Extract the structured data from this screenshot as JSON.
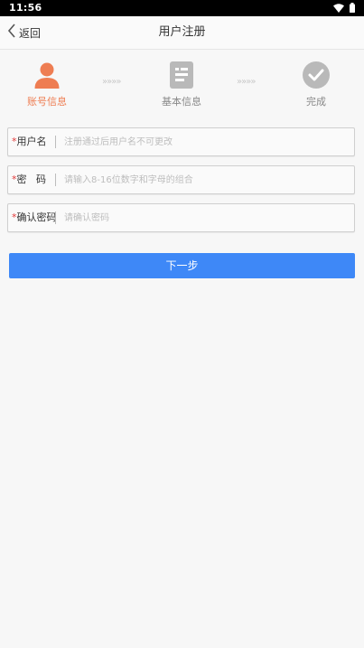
{
  "status_bar": {
    "time": "11:56",
    "icons": [
      "wifi-icon",
      "battery-icon"
    ]
  },
  "nav": {
    "back_label": "返回",
    "title": "用户注册"
  },
  "steps": [
    {
      "label": "账号信息",
      "icon": "user-icon",
      "active": true
    },
    {
      "label": "基本信息",
      "icon": "document-icon",
      "active": false
    },
    {
      "label": "完成",
      "icon": "check-circle-icon",
      "active": false
    }
  ],
  "step_arrow": "»»»»",
  "form": {
    "username": {
      "label": "用户名",
      "placeholder": "注册通过后用户名不可更改",
      "required_mark": "*"
    },
    "password": {
      "label": "密   码",
      "placeholder": "请输入8-16位数字和字母的组合",
      "required_mark": "*"
    },
    "confirm": {
      "label": "确认密码",
      "placeholder": "请确认密码",
      "required_mark": "*"
    }
  },
  "next_label": "下一步",
  "colors": {
    "accent": "#3e88f7",
    "active_step": "#ee7d52",
    "inactive_step": "#b9b9b9",
    "required": "#e23a3a"
  }
}
